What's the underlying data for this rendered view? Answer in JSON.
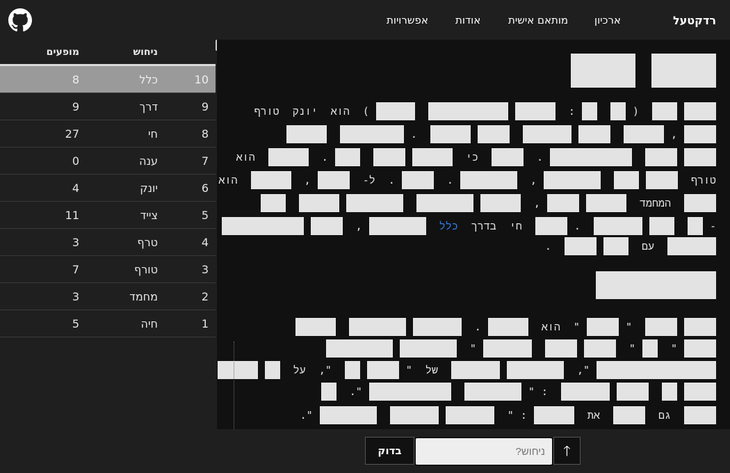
{
  "header": {
    "brand": "רדקטעל",
    "nav": [
      "ארכיון",
      "מותאם אישית",
      "אודות",
      "אפשרויות"
    ]
  },
  "table": {
    "headers": {
      "guess": "ניחוש",
      "occurrences": "מופעים"
    },
    "rows": [
      {
        "rank": "10",
        "word": "כלל",
        "count": "8"
      },
      {
        "rank": "9",
        "word": "דרך",
        "count": "9"
      },
      {
        "rank": "8",
        "word": "חי",
        "count": "27"
      },
      {
        "rank": "7",
        "word": "ענה",
        "count": "0"
      },
      {
        "rank": "6",
        "word": "יונק",
        "count": "4"
      },
      {
        "rank": "5",
        "word": "צייד",
        "count": "11"
      },
      {
        "rank": "4",
        "word": "טרף",
        "count": "3"
      },
      {
        "rank": "3",
        "word": "טורף",
        "count": "7"
      },
      {
        "rank": "2",
        "word": "מחמד",
        "count": "3"
      },
      {
        "rank": "1",
        "word": "חיה",
        "count": "5"
      }
    ]
  },
  "article": {
    "w": {
      "hu": "הוא",
      "yonek": "יונק",
      "toref": "טורף",
      "ki": "כי",
      "l": "ל-",
      "hamachmad": "המחמד",
      "chai": "חי",
      "bederech": "בדרך",
      "klal": "כלל",
      "im": "עם",
      "al": "על",
      "shel": "של",
      "gam": "גם",
      "et": "את"
    }
  },
  "footer": {
    "check_label": "בדוק",
    "guess_placeholder": "ניחוש?",
    "submit_icon": "arrow-up-icon"
  },
  "colors": {
    "accent_link": "#2f7ff0",
    "selected_row": "#9a9a9a"
  }
}
